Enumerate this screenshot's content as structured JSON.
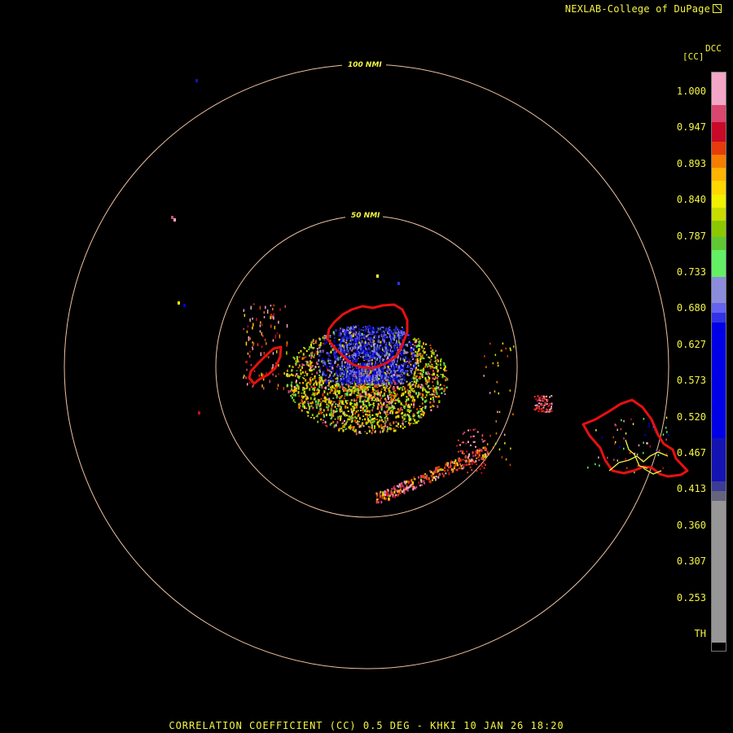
{
  "header": {
    "credit": "NEXLAB-College of DuPage",
    "credit_icon": "external-link-icon"
  },
  "radar": {
    "station": "KHKI",
    "product": "CORRELATION COEFFICIENT (CC)",
    "elevation": "0.5 DEG",
    "date": "10 JAN 26",
    "time": "18:20",
    "title": "CORRELATION COEFFICIENT (CC) 0.5 DEG - KHKI 10 JAN 26 18:20",
    "range_rings": [
      {
        "label": "50 NMI",
        "nmi": 50
      },
      {
        "label": "100 NMI",
        "nmi": 100
      }
    ],
    "ring_color": "#f0c0a0",
    "outline_color": "#e81010",
    "road_color": "#f5f542"
  },
  "legend": {
    "product_code": "DCC",
    "unit": "[CC]",
    "labels": [
      "1.000",
      "0.947",
      "0.893",
      "0.840",
      "0.787",
      "0.733",
      "0.680",
      "0.627",
      "0.573",
      "0.520",
      "0.467",
      "0.413",
      "0.360",
      "0.307",
      "0.253",
      "TH"
    ],
    "scale": [
      {
        "color": "#f4a6c6",
        "span": 1
      },
      {
        "color": "#d9466e",
        "span": 0.5
      },
      {
        "color": "#c80a28",
        "span": 0.6
      },
      {
        "color": "#e63c0a",
        "span": 0.4
      },
      {
        "color": "#f57d00",
        "span": 0.4
      },
      {
        "color": "#ffb400",
        "span": 0.4
      },
      {
        "color": "#ffd700",
        "span": 0.4
      },
      {
        "color": "#f0f000",
        "span": 0.4
      },
      {
        "color": "#c8dc00",
        "span": 0.4
      },
      {
        "color": "#8cc800",
        "span": 0.5
      },
      {
        "color": "#5fc832",
        "span": 0.4
      },
      {
        "color": "#64f064",
        "span": 0.8
      },
      {
        "color": "#8c8cdc",
        "span": 0.8
      },
      {
        "color": "#6464f0",
        "span": 0.3
      },
      {
        "color": "#3232e6",
        "span": 0.3
      },
      {
        "color": "#0000e6",
        "span": 3.5
      },
      {
        "color": "#1414b4",
        "span": 1.3
      },
      {
        "color": "#3c3c96",
        "span": 0.3
      },
      {
        "color": "#64647d",
        "span": 0.3
      },
      {
        "color": "#969696",
        "span": 4.3
      },
      {
        "color": "#000000",
        "span": 0.25
      }
    ]
  }
}
